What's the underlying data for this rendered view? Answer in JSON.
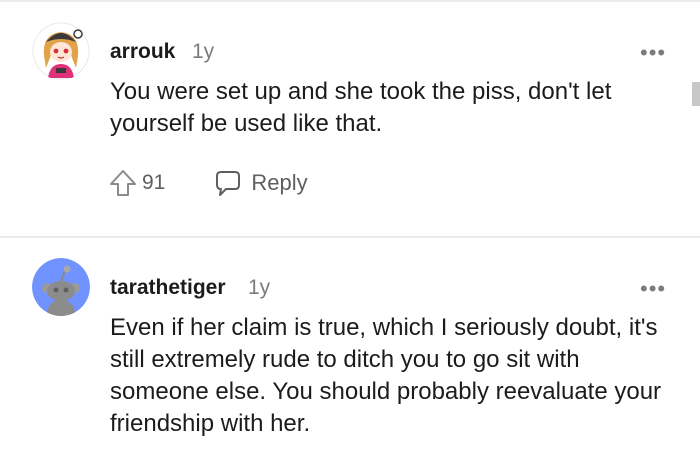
{
  "comments": [
    {
      "author": "arrouk",
      "age": "1y",
      "text": "You were set up and she took the piss, don't let yourself be used like that.",
      "votes": "91",
      "reply_label": "Reply",
      "avatar_icon": "anime-girl-avatar-icon"
    },
    {
      "author": "tarathetiger",
      "age": "1y",
      "text": "Even if her claim is true, which I seriously doubt, it's still extremely rude to ditch you to go sit with someone else. You should probably reevaluate your friendship with her.",
      "avatar_icon": "default-reddit-avatar-icon"
    }
  ],
  "more_label": "•••",
  "colors": {
    "text": "#1c1c1c",
    "muted": "#7c7c7c",
    "default_avatar_bg": "#7193ff",
    "divider": "#ececec"
  }
}
